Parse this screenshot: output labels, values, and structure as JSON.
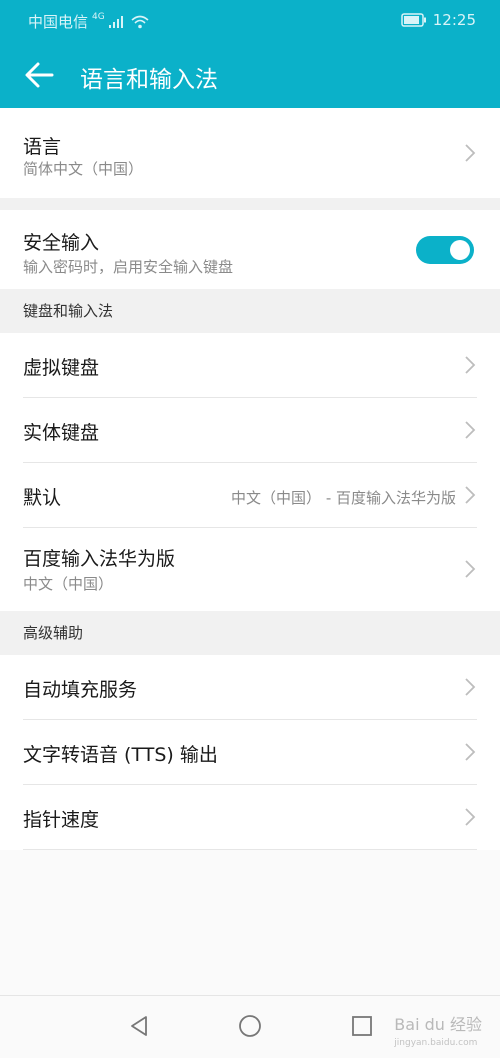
{
  "status_bar": {
    "carrier": "中国电信",
    "network": "4G",
    "time": "12:25"
  },
  "toolbar": {
    "title": "语言和输入法"
  },
  "settings": {
    "language": {
      "label": "语言",
      "value": "简体中文（中国）"
    },
    "secure_input": {
      "label": "安全输入",
      "desc": "输入密码时，启用安全输入键盘",
      "enabled": true
    },
    "keyboards_section": {
      "header": "键盘和输入法",
      "items": [
        {
          "label": "虚拟键盘"
        },
        {
          "label": "实体键盘"
        },
        {
          "label": "默认",
          "value": "中文（中国） - 百度输入法华为版"
        },
        {
          "label": "百度输入法华为版",
          "sub": "中文（中国）"
        }
      ]
    },
    "advanced_section": {
      "header": "高级辅助",
      "items": [
        {
          "label": "自动填充服务"
        },
        {
          "label": "文字转语音 (TTS) 输出"
        },
        {
          "label": "指针速度"
        }
      ]
    }
  },
  "watermark": {
    "brand": "Bai du 经验",
    "url": "jingyan.baidu.com"
  },
  "colors": {
    "accent": "#0bb1c9",
    "background": "#fafafa",
    "section_bg": "#f1f1f1"
  }
}
